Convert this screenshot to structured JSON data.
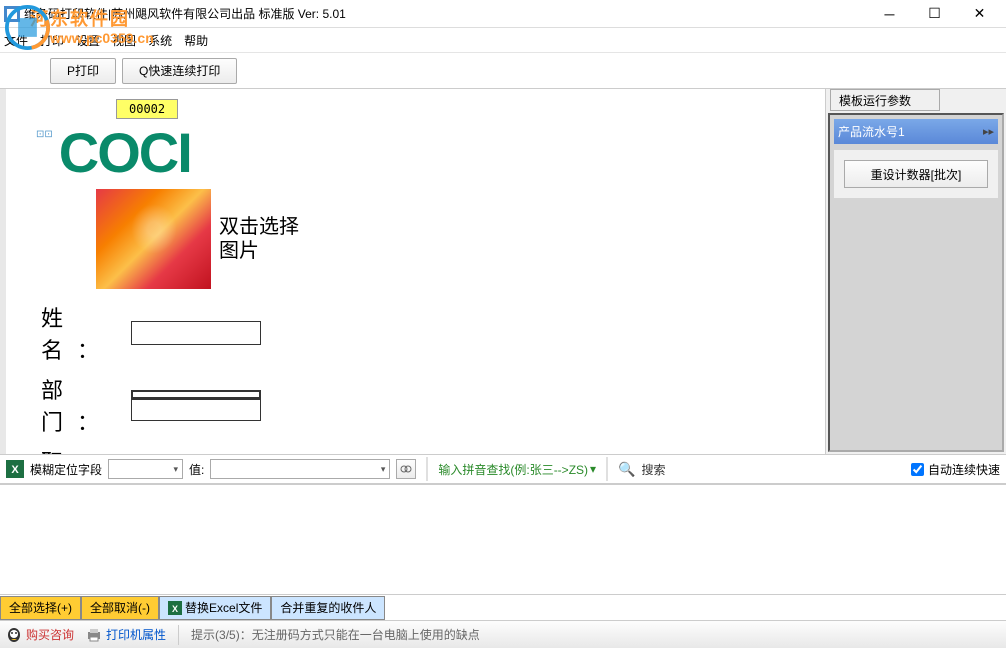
{
  "titlebar": {
    "title": "维条码打印软件|苏州飓风软件有限公司出品 标准版  Ver: 5.01"
  },
  "watermark": {
    "text": "河东软件园",
    "url": "www.pc0359.cn"
  },
  "menu": {
    "file": "文件",
    "print": "打印",
    "settings": "设置",
    "view": "视图",
    "system": "系统",
    "help": "帮助"
  },
  "toolbar": {
    "print": "P打印",
    "quick_print": "Q快速连续打印"
  },
  "canvas": {
    "serial": "00002",
    "logo_text": "COCI",
    "image_hint": "双击选择图片",
    "name_label": "姓名：",
    "dept_label": "部门：",
    "title_label": "职务："
  },
  "right_panel": {
    "tab": "模板运行参数",
    "serial_header": "产品流水号1",
    "reset_btn": "重设计数器[批次]"
  },
  "filter": {
    "fuzzy_label": "模糊定位字段",
    "value_label": "值:",
    "pinyin_hint": "输入拼音查找(例:张三-->ZS)",
    "search": "搜索",
    "auto_continuous": "自动连续快速"
  },
  "actions": {
    "select_all": "全部选择(+)",
    "deselect_all": "全部取消(-)",
    "replace_excel": "替换Excel文件",
    "merge_dup": "合并重复的收件人"
  },
  "status": {
    "buy": "购买咨询",
    "printer_prop": "打印机属性",
    "tip": "提示(3/5)：无注册码方式只能在一台电脑上使用的缺点"
  }
}
